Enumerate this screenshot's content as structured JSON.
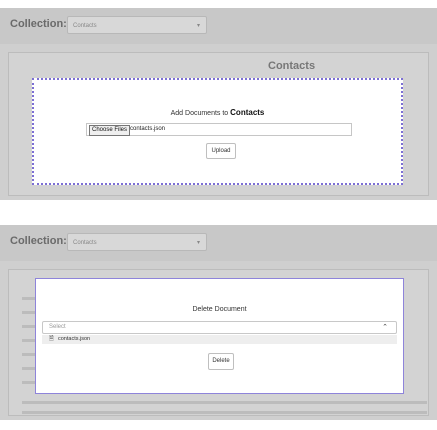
{
  "top_panel": {
    "collection_label": "Collection:",
    "collection_value": "Contacts",
    "background_title": "Contacts",
    "upload_modal": {
      "title_prefix": "Add Documents to",
      "title_collection": "Contacts",
      "choose_files_label": "Choose Files",
      "file_name": "contacts.json",
      "upload_label": "Upload"
    }
  },
  "bottom_panel": {
    "collection_label": "Collection:",
    "collection_value": "Contacts",
    "delete_modal": {
      "title": "Delete Document",
      "select_placeholder": "Select",
      "option_icon": "document-icon",
      "option_label": "contacts.json",
      "delete_label": "Delete"
    }
  },
  "colors": {
    "overlay_background": "#cfcfcf",
    "modal_border": "#7c6fd4"
  }
}
